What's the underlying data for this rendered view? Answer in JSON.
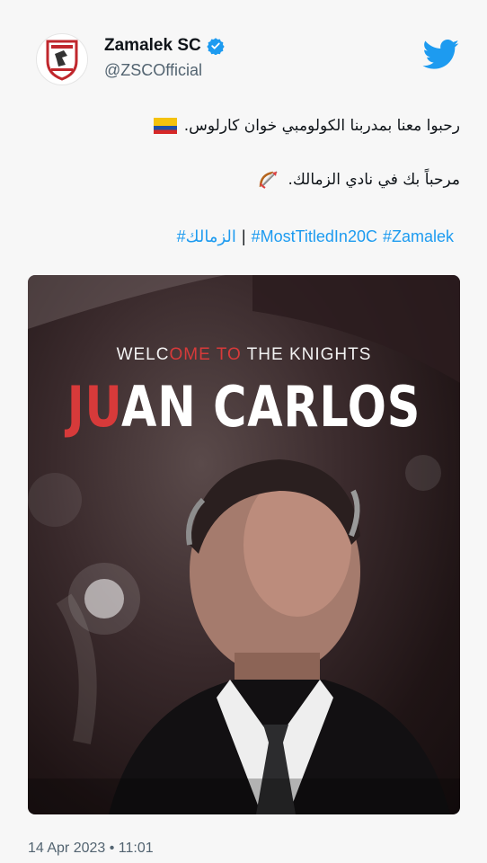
{
  "account": {
    "display_name": "Zamalek SC",
    "handle": "@ZSCOfficial"
  },
  "tweet": {
    "line1": "رحبوا معنا بمدربنا الكولومبي خوان كارلوس.",
    "line2": "مرحباً بك في نادي الزمالك.",
    "line1_icon": "colombia-flag-icon",
    "line2_icon": "bow-and-arrow-icon",
    "hashtag_1": "#الزمالك",
    "separator": "|",
    "hashtag_2": "#MostTitledIn20C",
    "hashtag_3": "#Zamalek",
    "timestamp": "14 Apr 2023 • 11:01"
  },
  "media": {
    "welcome_pre": "WELC",
    "welcome_red": "OME TO",
    "welcome_post": " THE KNIGHTS",
    "name_red": "JU",
    "name_white": "AN CARLOS"
  },
  "colors": {
    "link": "#1d9bf0",
    "verified": "#1d9bf0",
    "accent_red": "#d73a3a",
    "muted": "#536471"
  }
}
